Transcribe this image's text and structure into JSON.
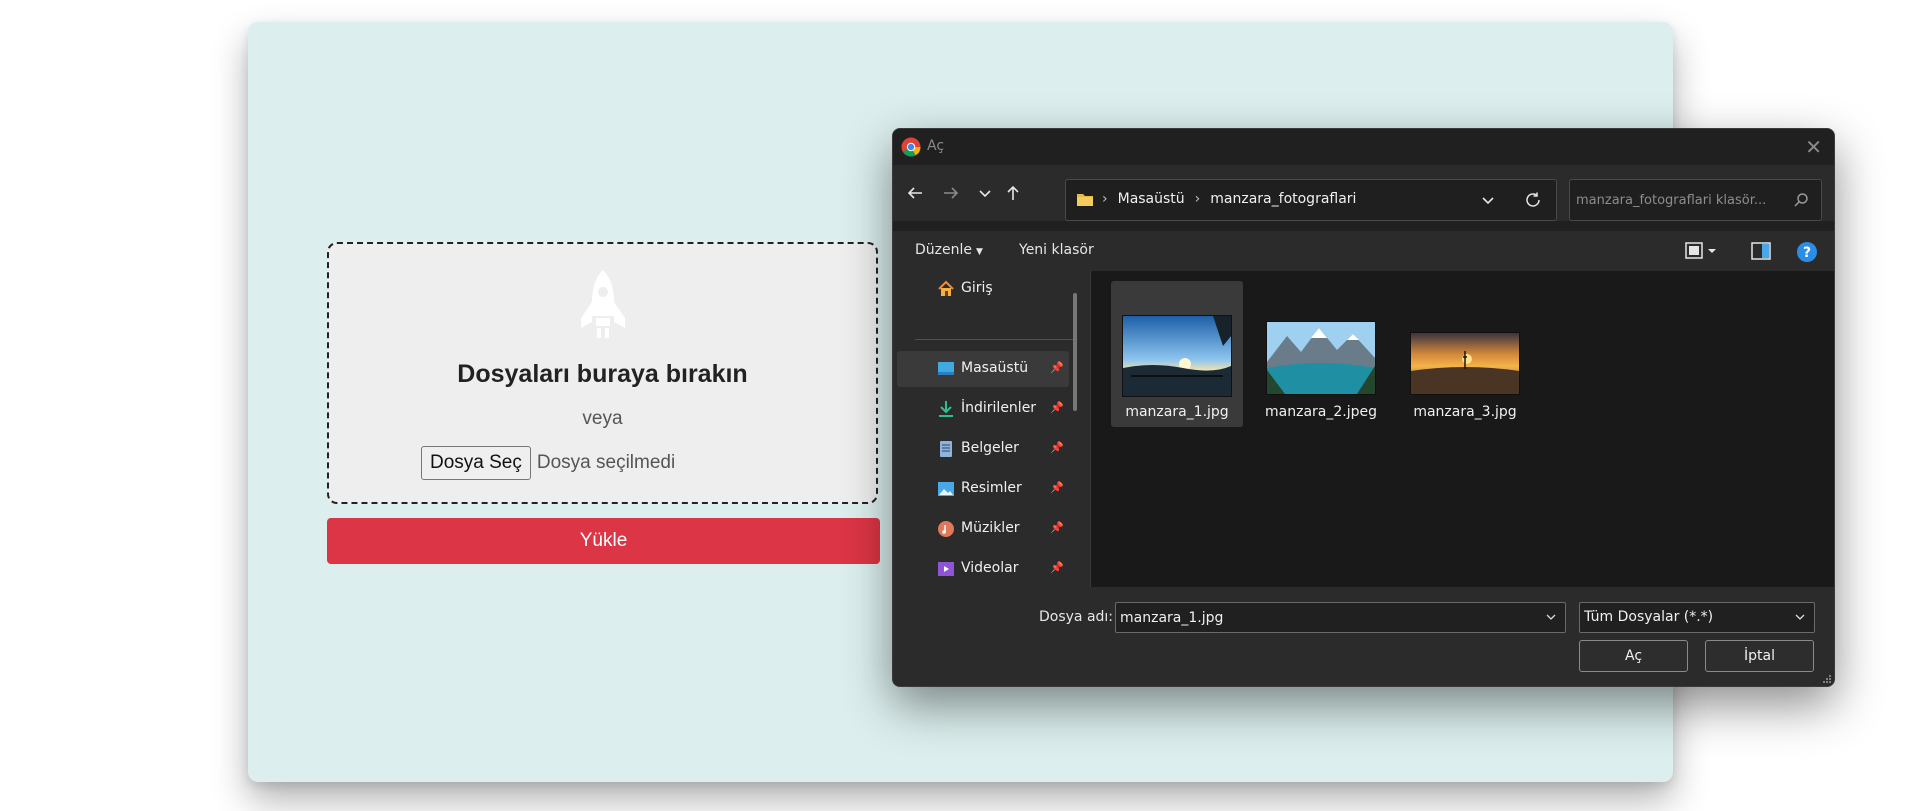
{
  "page": {
    "dropzone_title": "Dosyaları buraya bırakın",
    "or_text": "veya",
    "choose_file_label": "Dosya Seç",
    "no_file_text": "Dosya seçilmedi",
    "upload_label": "Yükle",
    "colors": {
      "background": "#dcefee",
      "upload_button": "#dc3545",
      "dropzone": "#eeeeee"
    },
    "icon": "rocket-icon"
  },
  "dialog": {
    "title": "Aç",
    "address": {
      "crumbs": [
        "Masaüstü",
        "manzara_fotograflari"
      ]
    },
    "search_placeholder": "manzara_fotograflari klasör...",
    "toolbar": {
      "organize_label": "Düzenle",
      "new_folder_label": "Yeni klasör"
    },
    "sidebar": {
      "home": "Giriş",
      "items": [
        {
          "label": "Masaüstü",
          "icon": "desktop-icon",
          "active": true
        },
        {
          "label": "İndirilenler",
          "icon": "download-icon"
        },
        {
          "label": "Belgeler",
          "icon": "documents-icon"
        },
        {
          "label": "Resimler",
          "icon": "pictures-icon"
        },
        {
          "label": "Müzikler",
          "icon": "music-icon"
        },
        {
          "label": "Videolar",
          "icon": "videos-icon"
        }
      ]
    },
    "files": [
      {
        "name": "manzara_1.jpg",
        "selected": true
      },
      {
        "name": "manzara_2.jpeg"
      },
      {
        "name": "manzara_3.jpg"
      }
    ],
    "filename_label": "Dosya adı:",
    "filename_value": "manzara_1.jpg",
    "filetype_value": "Tüm Dosyalar (*.*)",
    "open_label": "Aç",
    "cancel_label": "İptal"
  }
}
